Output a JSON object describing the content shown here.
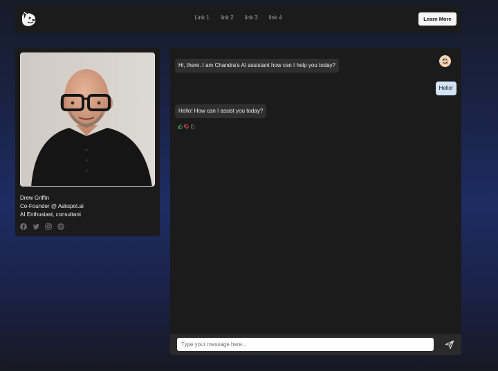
{
  "nav": {
    "links": [
      "Link 1",
      "link 2",
      "link 3",
      "link 4"
    ],
    "cta_label": "Learn More"
  },
  "profile": {
    "name": "Drew Griffin",
    "role": "Co-Founder @ Askspot.ai",
    "tagline": "AI Enthusiast, consultant",
    "socials": [
      "facebook-icon",
      "twitter-icon",
      "instagram-icon",
      "globe-icon"
    ]
  },
  "chat": {
    "messages": [
      {
        "from": "bot",
        "text": "Hi, there. I am Chandra's AI assistant how can I help you today?"
      },
      {
        "from": "user",
        "text": "Hello!"
      },
      {
        "from": "bot",
        "text": "Hello! How can I assist you today?"
      }
    ],
    "input_placeholder": "Type your message here...",
    "input_value": ""
  },
  "colors": {
    "accent_refresh": "#f6d2b3",
    "user_bubble": "#d3e4f6",
    "thumb_up": "#3fbf63",
    "thumb_down": "#e05151"
  }
}
